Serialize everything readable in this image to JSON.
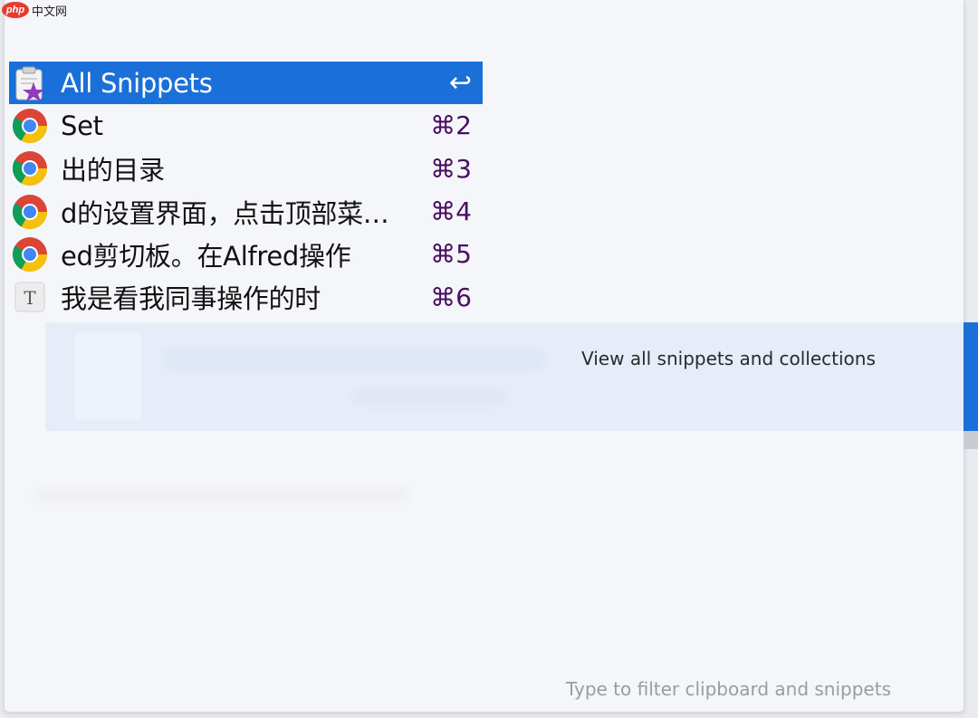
{
  "watermark": {
    "badge": "php",
    "text": "中文网"
  },
  "list": {
    "items": [
      {
        "label": "All Snippets",
        "shortcut": "↩",
        "icon": "snippets-clipboard-icon",
        "selected": true
      },
      {
        "label": "Set",
        "shortcut": "⌘2",
        "icon": "chrome-icon"
      },
      {
        "label": "出的目录",
        "shortcut": "⌘3",
        "icon": "chrome-icon"
      },
      {
        "label": "d的设置界面，点击顶部菜…",
        "shortcut": "⌘4",
        "icon": "chrome-icon"
      },
      {
        "label": "ed剪切板。在Alfred操作",
        "shortcut": "⌘5",
        "icon": "chrome-icon"
      },
      {
        "label": "我是看我同事操作的时",
        "shortcut": "⌘6",
        "icon": "text-icon"
      }
    ]
  },
  "text_icon": {
    "glyph": "T"
  },
  "preview": {
    "caption": "View all snippets and collections"
  },
  "footer": {
    "hint": "Type to filter clipboard and snippets"
  },
  "colors": {
    "selection": "#1a6fd8",
    "shortcut": "#4a0e63",
    "background": "#f5f6fa"
  }
}
